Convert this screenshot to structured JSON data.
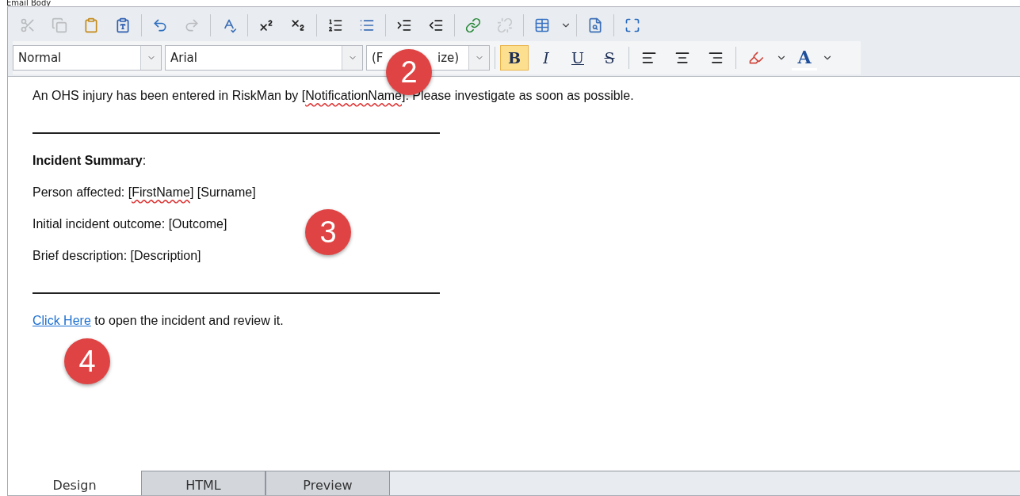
{
  "field_label": "Email Body",
  "toolbar": [
    {
      "disabled": true
    },
    {
      "disabled": true
    },
    {
      "disabled": false
    },
    {
      "disabled": false
    },
    {
      "disabled": false
    },
    {
      "disabled": true
    },
    {
      "disabled": false
    },
    {
      "disabled": false
    },
    {
      "disabled": false
    },
    {
      "disabled": false
    },
    {
      "disabled": false
    },
    {
      "disabled": false
    },
    {
      "disabled": false
    },
    {
      "disabled": false
    },
    {
      "disabled": true
    },
    {
      "disabled": false
    },
    {
      "disabled": false
    },
    {
      "disabled": false
    }
  ],
  "format_bar": {
    "style": "Normal",
    "font": "Arial",
    "size_parts": [
      "(F",
      "ize)"
    ],
    "styles": [
      {
        "label": "B",
        "selected": true
      },
      {
        "label": "I",
        "selected": false
      },
      {
        "label": "U",
        "selected": false
      },
      {
        "label": "S",
        "selected": false
      }
    ],
    "font_color_label": "A"
  },
  "body": [
    {
      "kind": "text",
      "segments": [
        {
          "kind": "plain",
          "text": "An OHS injury has been entered in RiskMan by ["
        },
        {
          "kind": "misspelled",
          "text": "NotificationName"
        },
        {
          "kind": "plain",
          "text": "]. Please investigate as soon as possible."
        }
      ]
    },
    {
      "kind": "rule"
    },
    {
      "kind": "text",
      "segments": [
        {
          "kind": "bold",
          "text": "Incident Summary"
        },
        {
          "kind": "plain",
          "text": ":"
        }
      ]
    },
    {
      "kind": "text",
      "segments": [
        {
          "kind": "plain",
          "text": "Person affected: ["
        },
        {
          "kind": "misspelled",
          "text": "FirstName"
        },
        {
          "kind": "plain",
          "text": "] [Surname]"
        }
      ]
    },
    {
      "kind": "text",
      "segments": [
        {
          "kind": "plain",
          "text": "Initial incident outcome: [Outcome]"
        }
      ]
    },
    {
      "kind": "text",
      "segments": [
        {
          "kind": "plain",
          "text": "Brief description: [Description]"
        }
      ]
    },
    {
      "kind": "rule"
    },
    {
      "kind": "link",
      "link": "Click Here",
      "text": " to open the incident and review it."
    }
  ],
  "badges": [
    "2",
    "3",
    "4"
  ],
  "tabs": [
    {
      "label": "Design",
      "selected": true
    },
    {
      "label": "HTML",
      "selected": false
    },
    {
      "label": "Preview",
      "selected": false
    }
  ]
}
